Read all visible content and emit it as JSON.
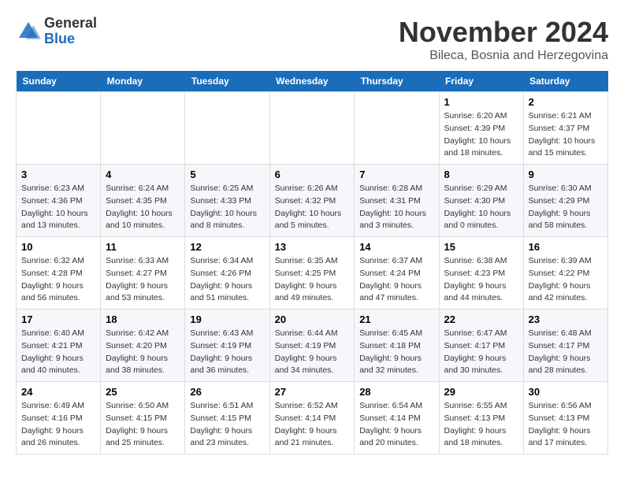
{
  "header": {
    "logo_general": "General",
    "logo_blue": "Blue",
    "month": "November 2024",
    "location": "Bileca, Bosnia and Herzegovina"
  },
  "days_of_week": [
    "Sunday",
    "Monday",
    "Tuesday",
    "Wednesday",
    "Thursday",
    "Friday",
    "Saturday"
  ],
  "weeks": [
    [
      {
        "day": "",
        "info": ""
      },
      {
        "day": "",
        "info": ""
      },
      {
        "day": "",
        "info": ""
      },
      {
        "day": "",
        "info": ""
      },
      {
        "day": "",
        "info": ""
      },
      {
        "day": "1",
        "info": "Sunrise: 6:20 AM\nSunset: 4:39 PM\nDaylight: 10 hours and 18 minutes."
      },
      {
        "day": "2",
        "info": "Sunrise: 6:21 AM\nSunset: 4:37 PM\nDaylight: 10 hours and 15 minutes."
      }
    ],
    [
      {
        "day": "3",
        "info": "Sunrise: 6:23 AM\nSunset: 4:36 PM\nDaylight: 10 hours and 13 minutes."
      },
      {
        "day": "4",
        "info": "Sunrise: 6:24 AM\nSunset: 4:35 PM\nDaylight: 10 hours and 10 minutes."
      },
      {
        "day": "5",
        "info": "Sunrise: 6:25 AM\nSunset: 4:33 PM\nDaylight: 10 hours and 8 minutes."
      },
      {
        "day": "6",
        "info": "Sunrise: 6:26 AM\nSunset: 4:32 PM\nDaylight: 10 hours and 5 minutes."
      },
      {
        "day": "7",
        "info": "Sunrise: 6:28 AM\nSunset: 4:31 PM\nDaylight: 10 hours and 3 minutes."
      },
      {
        "day": "8",
        "info": "Sunrise: 6:29 AM\nSunset: 4:30 PM\nDaylight: 10 hours and 0 minutes."
      },
      {
        "day": "9",
        "info": "Sunrise: 6:30 AM\nSunset: 4:29 PM\nDaylight: 9 hours and 58 minutes."
      }
    ],
    [
      {
        "day": "10",
        "info": "Sunrise: 6:32 AM\nSunset: 4:28 PM\nDaylight: 9 hours and 56 minutes."
      },
      {
        "day": "11",
        "info": "Sunrise: 6:33 AM\nSunset: 4:27 PM\nDaylight: 9 hours and 53 minutes."
      },
      {
        "day": "12",
        "info": "Sunrise: 6:34 AM\nSunset: 4:26 PM\nDaylight: 9 hours and 51 minutes."
      },
      {
        "day": "13",
        "info": "Sunrise: 6:35 AM\nSunset: 4:25 PM\nDaylight: 9 hours and 49 minutes."
      },
      {
        "day": "14",
        "info": "Sunrise: 6:37 AM\nSunset: 4:24 PM\nDaylight: 9 hours and 47 minutes."
      },
      {
        "day": "15",
        "info": "Sunrise: 6:38 AM\nSunset: 4:23 PM\nDaylight: 9 hours and 44 minutes."
      },
      {
        "day": "16",
        "info": "Sunrise: 6:39 AM\nSunset: 4:22 PM\nDaylight: 9 hours and 42 minutes."
      }
    ],
    [
      {
        "day": "17",
        "info": "Sunrise: 6:40 AM\nSunset: 4:21 PM\nDaylight: 9 hours and 40 minutes."
      },
      {
        "day": "18",
        "info": "Sunrise: 6:42 AM\nSunset: 4:20 PM\nDaylight: 9 hours and 38 minutes."
      },
      {
        "day": "19",
        "info": "Sunrise: 6:43 AM\nSunset: 4:19 PM\nDaylight: 9 hours and 36 minutes."
      },
      {
        "day": "20",
        "info": "Sunrise: 6:44 AM\nSunset: 4:19 PM\nDaylight: 9 hours and 34 minutes."
      },
      {
        "day": "21",
        "info": "Sunrise: 6:45 AM\nSunset: 4:18 PM\nDaylight: 9 hours and 32 minutes."
      },
      {
        "day": "22",
        "info": "Sunrise: 6:47 AM\nSunset: 4:17 PM\nDaylight: 9 hours and 30 minutes."
      },
      {
        "day": "23",
        "info": "Sunrise: 6:48 AM\nSunset: 4:17 PM\nDaylight: 9 hours and 28 minutes."
      }
    ],
    [
      {
        "day": "24",
        "info": "Sunrise: 6:49 AM\nSunset: 4:16 PM\nDaylight: 9 hours and 26 minutes."
      },
      {
        "day": "25",
        "info": "Sunrise: 6:50 AM\nSunset: 4:15 PM\nDaylight: 9 hours and 25 minutes."
      },
      {
        "day": "26",
        "info": "Sunrise: 6:51 AM\nSunset: 4:15 PM\nDaylight: 9 hours and 23 minutes."
      },
      {
        "day": "27",
        "info": "Sunrise: 6:52 AM\nSunset: 4:14 PM\nDaylight: 9 hours and 21 minutes."
      },
      {
        "day": "28",
        "info": "Sunrise: 6:54 AM\nSunset: 4:14 PM\nDaylight: 9 hours and 20 minutes."
      },
      {
        "day": "29",
        "info": "Sunrise: 6:55 AM\nSunset: 4:13 PM\nDaylight: 9 hours and 18 minutes."
      },
      {
        "day": "30",
        "info": "Sunrise: 6:56 AM\nSunset: 4:13 PM\nDaylight: 9 hours and 17 minutes."
      }
    ]
  ]
}
